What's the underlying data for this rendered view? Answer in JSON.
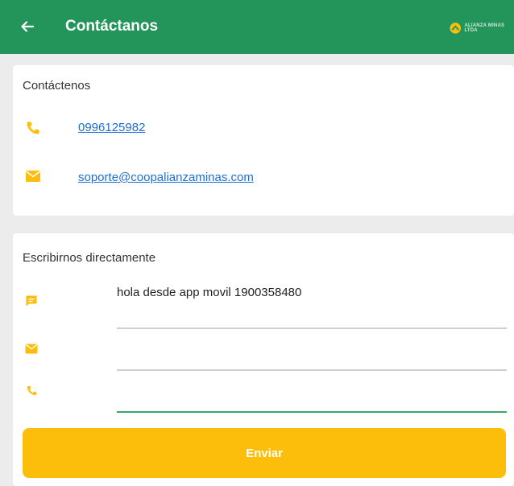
{
  "appbar": {
    "title": "Contáctanos",
    "back_icon": "arrow-left-icon",
    "logo_text": "ALIANZA MINAS LTDA",
    "logo_icon": "brand-logo-icon"
  },
  "contact_card": {
    "heading": "Contáctenos",
    "phone": {
      "icon": "phone-icon",
      "value": "0996125982"
    },
    "email": {
      "icon": "mail-icon",
      "value": "soporte@coopalianzaminas.com"
    }
  },
  "message_card": {
    "heading": "Escribirnos directamente",
    "message_field": {
      "icon": "chat-icon",
      "value": "hola desde app movil 1900358480"
    },
    "email_field": {
      "icon": "mail-icon",
      "value": "",
      "placeholder": ""
    },
    "phone_field": {
      "icon": "phone-icon",
      "value": "",
      "placeholder": ""
    },
    "send_label": "Enviar"
  },
  "colors": {
    "primary": "#23955a",
    "accent": "#fdbd0b",
    "link": "#1e6fd1"
  }
}
